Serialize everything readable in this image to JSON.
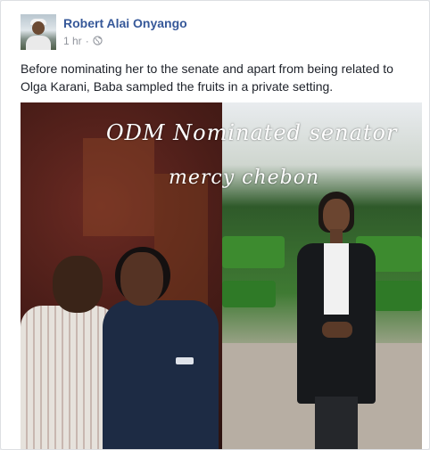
{
  "post": {
    "author": "Robert Alai Onyango",
    "time": "1 hr",
    "separator": "·",
    "privacy_icon": "globe-icon",
    "menu_icon": "chevron-down-icon",
    "text": "Before nominating her to the senate and apart from being related to Olga Karani, Baba sampled the fruits in a private setting."
  },
  "image": {
    "caption_line1": "ODM Nominated senator",
    "caption_line2": "mercy chebon"
  },
  "colors": {
    "author_link": "#365899",
    "meta_text": "#90949c",
    "body_text": "#1d2129",
    "card_border": "#dddfe2"
  }
}
